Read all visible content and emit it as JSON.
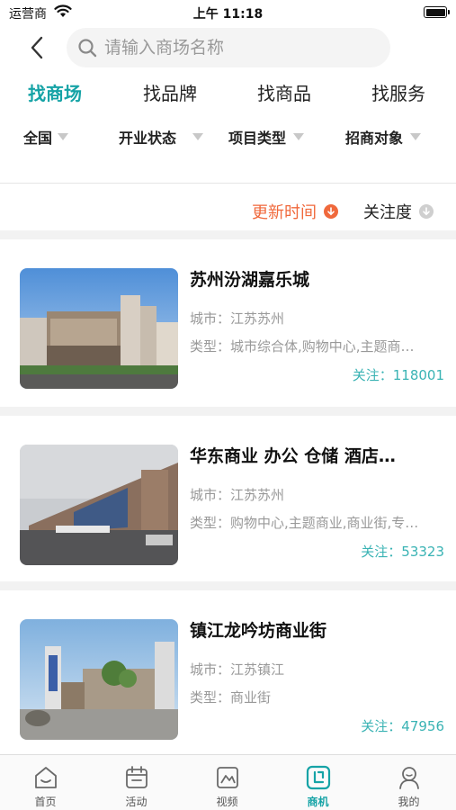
{
  "status_bar": {
    "carrier": "运营商",
    "time": "上午 11:18"
  },
  "search": {
    "placeholder": "请输入商场名称"
  },
  "category_tabs": [
    {
      "label": "找商场",
      "active": true
    },
    {
      "label": "找品牌",
      "active": false
    },
    {
      "label": "找商品",
      "active": false
    },
    {
      "label": "找服务",
      "active": false
    }
  ],
  "filters": [
    {
      "label": "全国"
    },
    {
      "label": "开业状态"
    },
    {
      "label": "项目类型"
    },
    {
      "label": "招商对象"
    }
  ],
  "sort": [
    {
      "label": "更新时间",
      "active": true
    },
    {
      "label": "关注度",
      "active": false
    }
  ],
  "listings": [
    {
      "title": "苏州汾湖嘉乐城",
      "city": "城市：江苏苏州",
      "type": "类型：城市综合体,购物中心,主题商…",
      "follow": "关注：118001"
    },
    {
      "title": "华东商业 办公 仓储 酒店…",
      "city": "城市：江苏苏州",
      "type": "类型：购物中心,主题商业,商业街,专…",
      "follow": "关注：53323"
    },
    {
      "title": "镇江龙吟坊商业街",
      "city": "城市：江苏镇江",
      "type": "类型：商业街",
      "follow": "关注：47956"
    }
  ],
  "tab_bar": [
    {
      "label": "首页",
      "icon": "home-icon",
      "active": false
    },
    {
      "label": "活动",
      "icon": "calendar-icon",
      "active": false
    },
    {
      "label": "视频",
      "icon": "video-icon",
      "active": false
    },
    {
      "label": "商机",
      "icon": "opportunity-icon",
      "active": true
    },
    {
      "label": "我的",
      "icon": "profile-icon",
      "active": false
    }
  ],
  "colors": {
    "accent": "#16a3a6",
    "sort_active": "#f0693c",
    "follow_text": "#3ab3b4",
    "muted_text": "#999999"
  }
}
